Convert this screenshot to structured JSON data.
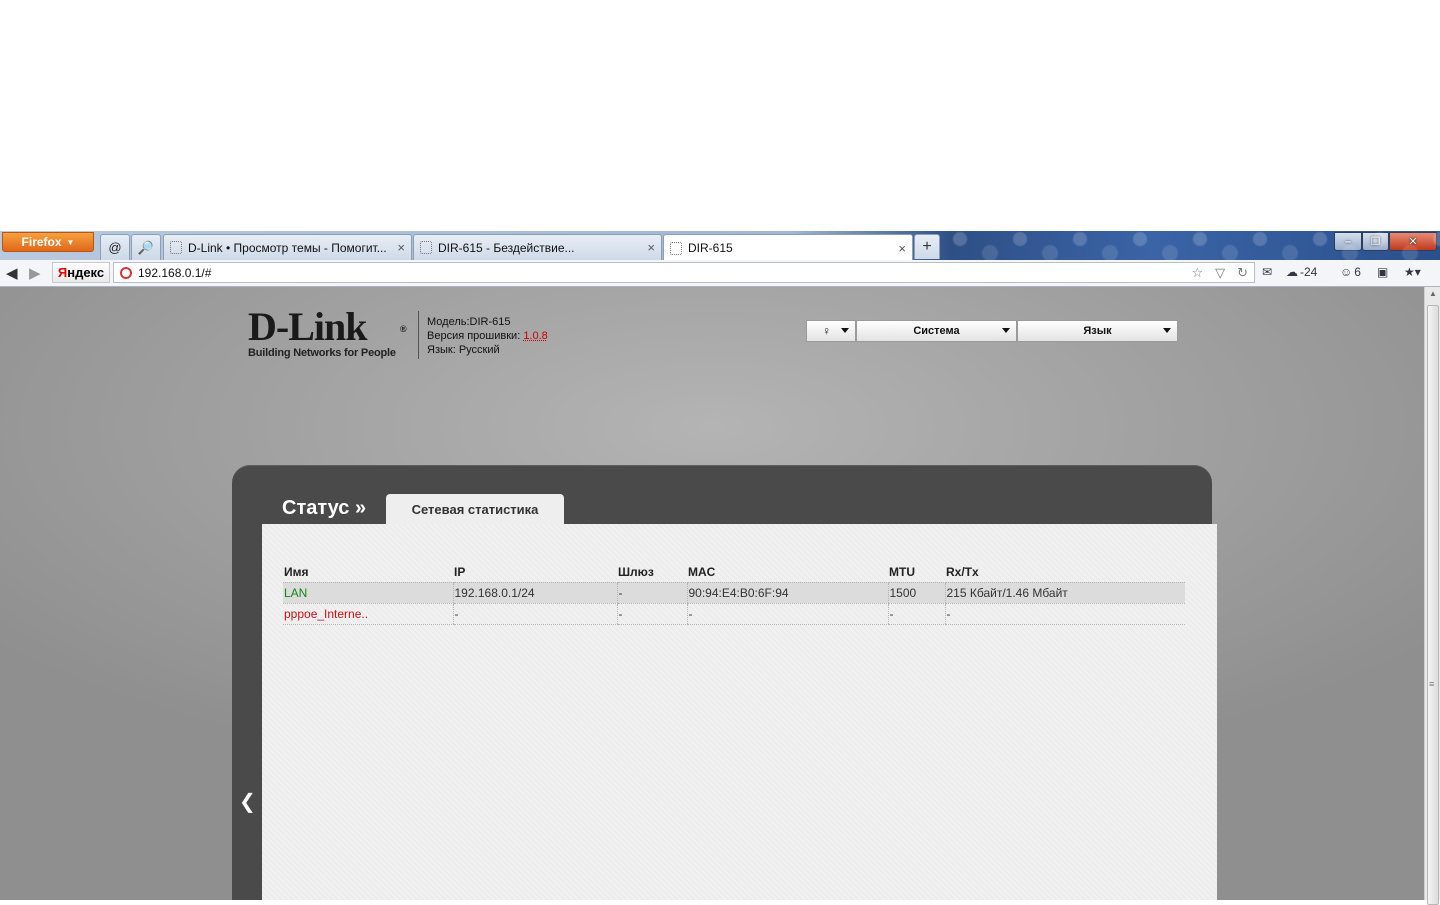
{
  "browser": {
    "menu_label": "Firefox",
    "tabs": [
      {
        "title": "D-Link • Просмотр темы - Помогит...",
        "close": "×"
      },
      {
        "title": "DIR-615 - Бездействие...",
        "close": "×"
      },
      {
        "title": "DIR-615",
        "close": "×"
      }
    ],
    "new_tab": "+",
    "search_brand": {
      "first": "Я",
      "rest": "ндекс"
    },
    "url": "192.168.0.1/#",
    "weather": "-24",
    "notifications_count": "6",
    "window_controls": {
      "minimize": "–",
      "restore": "❐",
      "close": "✕"
    }
  },
  "router": {
    "logo": {
      "brand": "D-Link",
      "mark": "®",
      "tagline": "Building Networks for People"
    },
    "device": {
      "model_label": "Модель:",
      "model": "DIR-615",
      "firmware_label": "Версия прошивки:",
      "firmware": "1.0.8",
      "language_label": "Язык:",
      "language": "Русский"
    },
    "menu": {
      "system": "Система",
      "language": "Язык"
    },
    "section": "Статус »",
    "active_tab": "Сетевая статистика",
    "table": {
      "headers": [
        "Имя",
        "IP",
        "Шлюз",
        "MAC",
        "MTU",
        "Rx/Tx"
      ],
      "rows": [
        {
          "name": "LAN",
          "ip": "192.168.0.1/24",
          "gateway": "-",
          "mac": "90:94:E4:B0:6F:94",
          "mtu": "1500",
          "rxtx": "215 Кбайт/1.46 Мбайт"
        },
        {
          "name": "pppoe_Interne..",
          "ip": "-",
          "gateway": "-",
          "mac": "-",
          "mtu": "-",
          "rxtx": "-"
        }
      ]
    }
  },
  "colors": {
    "lan": "#118811",
    "pppoe": "#cc1111",
    "panel": "#4a4a4a",
    "firefox": "#e0681a"
  }
}
